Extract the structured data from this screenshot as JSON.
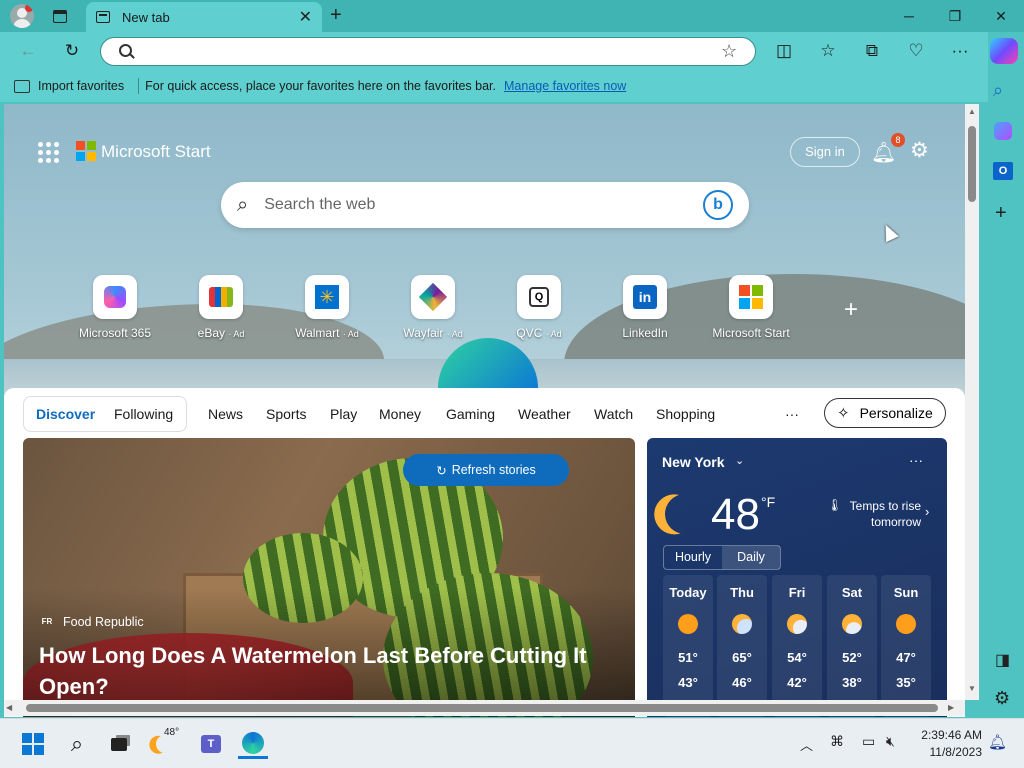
{
  "window": {
    "tab_title": "New tab",
    "controls": {
      "minimize": "─",
      "restore": "❐",
      "close": "✕"
    }
  },
  "favorites_bar": {
    "import_label": "Import favorites",
    "message": "For quick access, place your favorites here on the favorites bar.",
    "manage_link": "Manage favorites now"
  },
  "start": {
    "brand": "Microsoft Start",
    "sign_in": "Sign in",
    "notification_count": "8",
    "search_placeholder": "Search the web",
    "quick_links": [
      {
        "label": "Microsoft 365",
        "ad": ""
      },
      {
        "label": "eBay",
        "ad": "· Ad"
      },
      {
        "label": "Walmart",
        "ad": "· Ad"
      },
      {
        "label": "Wayfair",
        "ad": "· Ad"
      },
      {
        "label": "QVC",
        "ad": "· Ad"
      },
      {
        "label": "LinkedIn",
        "ad": ""
      },
      {
        "label": "Microsoft Start",
        "ad": ""
      }
    ]
  },
  "feed": {
    "tabs": [
      "Discover",
      "Following"
    ],
    "nav": [
      "News",
      "Sports",
      "Play",
      "Money",
      "Gaming",
      "Weather",
      "Watch",
      "Shopping"
    ],
    "more": "···",
    "personalize": "Personalize",
    "refresh": "Refresh stories",
    "hero": {
      "source_badge": "FR",
      "source": "Food Republic",
      "headline": "How Long Does A Watermelon Last Before Cutting It Open?"
    }
  },
  "weather": {
    "city": "New York",
    "temp": "48",
    "unit": "°F",
    "note": "Temps to rise tomorrow",
    "tabs": [
      "Hourly",
      "Daily"
    ],
    "days": [
      {
        "name": "Today",
        "high": "51°",
        "low": "43°"
      },
      {
        "name": "Thu",
        "high": "65°",
        "low": "46°"
      },
      {
        "name": "Fri",
        "high": "54°",
        "low": "42°"
      },
      {
        "name": "Sat",
        "high": "52°",
        "low": "38°"
      },
      {
        "name": "Sun",
        "high": "47°",
        "low": "35°"
      }
    ]
  },
  "taskbar": {
    "weather_temp": "48°",
    "time": "2:39:46 AM",
    "date": "11/8/2023"
  }
}
